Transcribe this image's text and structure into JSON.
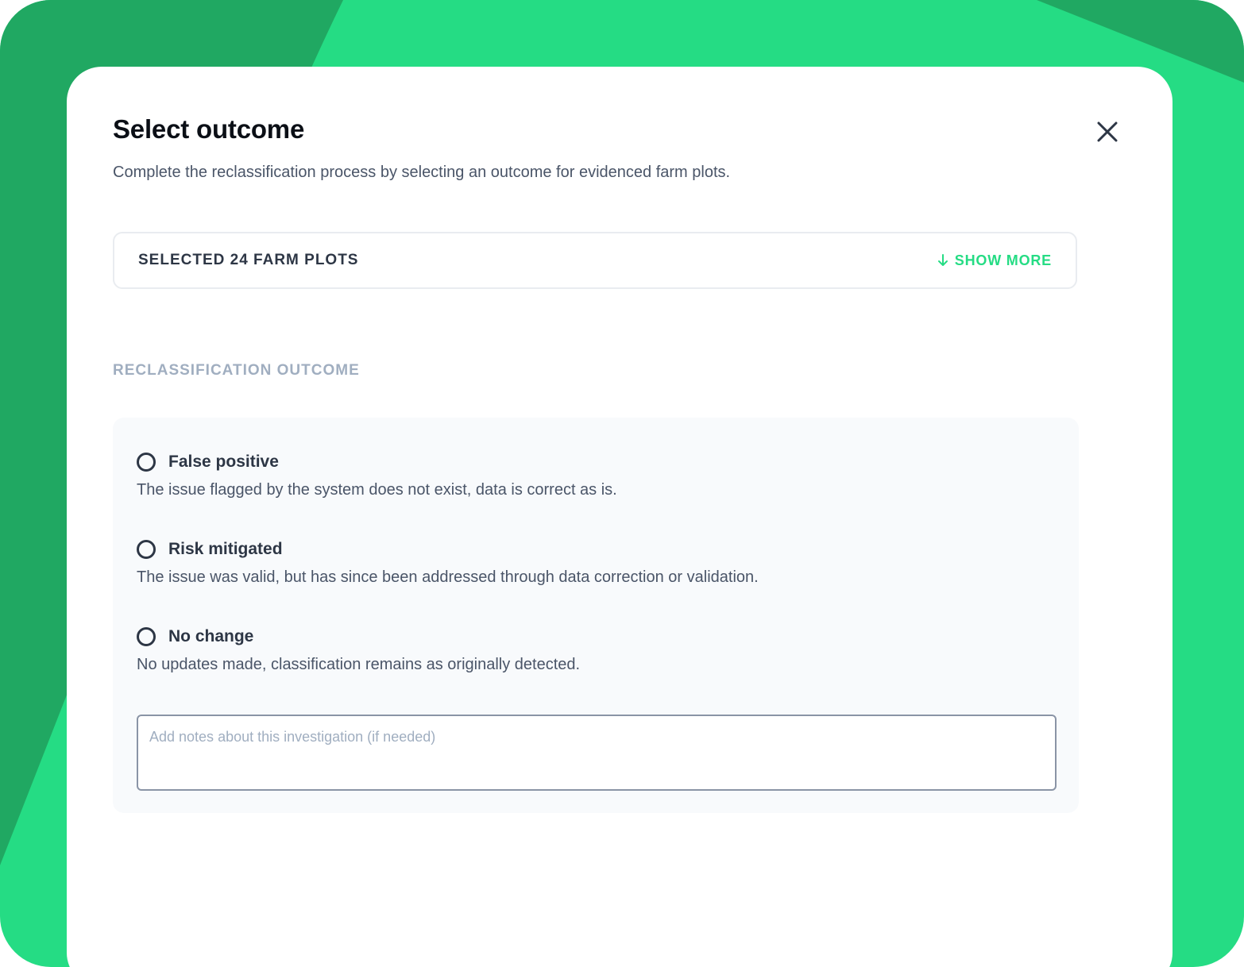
{
  "modal": {
    "title": "Select outcome",
    "subtitle": "Complete the reclassification process by selecting an outcome for evidenced farm plots.",
    "close_icon": "close-icon"
  },
  "selection": {
    "label": "SELECTED 24 FARM PLOTS",
    "show_more_label": "SHOW MORE",
    "show_more_icon": "arrow-down-icon"
  },
  "outcome": {
    "section_label": "RECLASSIFICATION OUTCOME",
    "options": [
      {
        "title": "False positive",
        "description": "The issue flagged by the system does not exist, data is correct as is.",
        "selected": false
      },
      {
        "title": "Risk mitigated",
        "description": "The issue was valid, but has since been addressed through data correction or validation.",
        "selected": false
      },
      {
        "title": "No change",
        "description": "No updates made, classification remains as originally detected.",
        "selected": false
      }
    ],
    "notes": {
      "value": "",
      "placeholder": "Add notes about this investigation (if needed)"
    }
  },
  "colors": {
    "accent": "#25dc84",
    "accent_dark": "#20a862",
    "text_dark": "#2d3645",
    "text_muted": "#a0aec0"
  }
}
